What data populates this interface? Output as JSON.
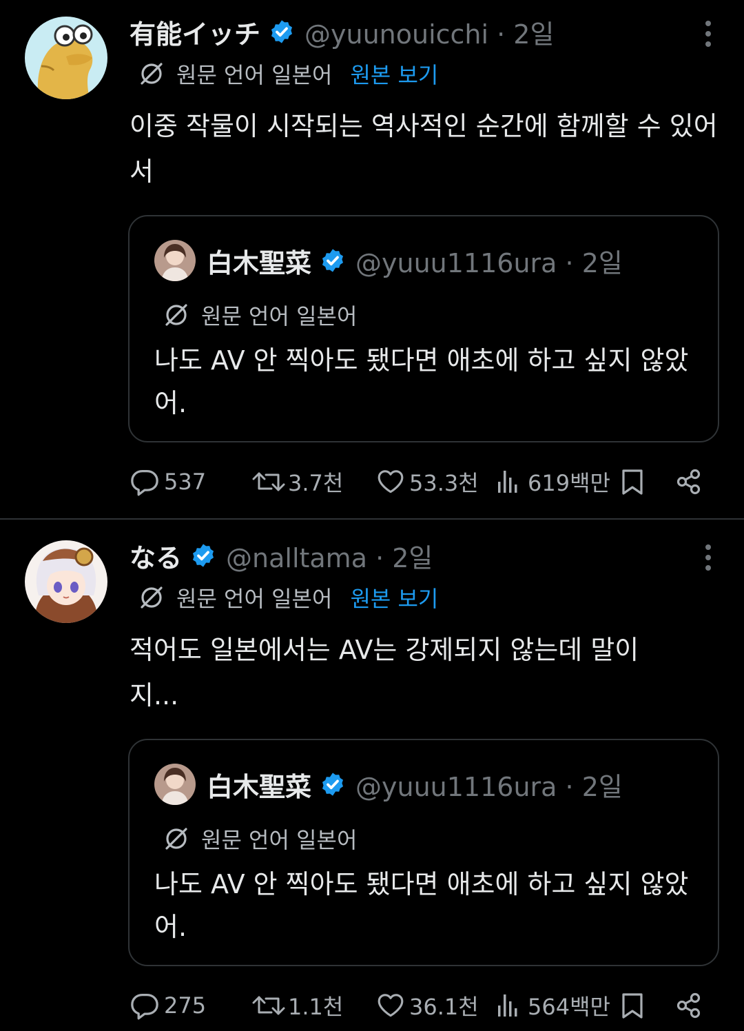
{
  "translate_label": "원문 언어 일본어",
  "view_original": "원본 보기",
  "colors": {
    "background": "#000000",
    "text": "#e7e9ea",
    "muted": "#71767b",
    "accent": "#1d9bf0",
    "border": "#2f3336"
  },
  "tweets": [
    {
      "name": "有能イッチ",
      "handle": "@yuunouicchi · 2일",
      "text": "이중 작물이 시작되는 역사적인 순간에 함께할 수 있어서",
      "quote": {
        "name": "白木聖菜",
        "handle": "@yuuu1116ura · 2일",
        "text": "나도 AV 안 찍아도 됐다면 애초에 하고 싶지 않았어."
      },
      "stats": {
        "replies": "537",
        "reposts": "3.7천",
        "likes": "53.3천",
        "views": "619백만"
      }
    },
    {
      "name": "なる",
      "handle": "@nalltama · 2일",
      "text": "적어도 일본에서는 AV는 강제되지 않는데 말이지...",
      "quote": {
        "name": "白木聖菜",
        "handle": "@yuuu1116ura · 2일",
        "text": "나도 AV 안 찍아도 됐다면 애초에 하고 싶지 않았어."
      },
      "stats": {
        "replies": "275",
        "reposts": "1.1천",
        "likes": "36.1천",
        "views": "564백만"
      }
    }
  ]
}
